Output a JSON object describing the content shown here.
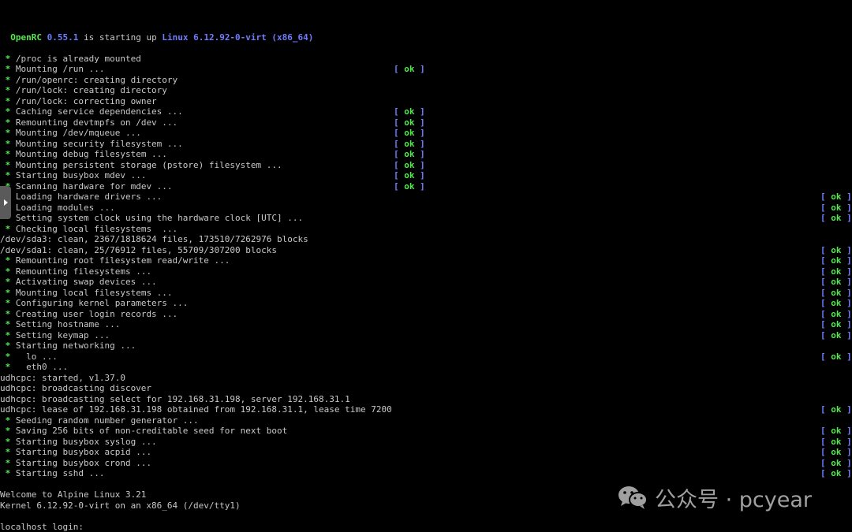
{
  "colors": {
    "background": "#000000",
    "text": "#c9c9c9",
    "green": "#55e84f",
    "blue": "#6f7cff",
    "side_tab": "#5a5a5a"
  },
  "console": {
    "lines": [
      {
        "row": 3,
        "indent": 1,
        "segments": [
          {
            "text": "OpenRC",
            "color": "green"
          },
          {
            "text": " "
          },
          {
            "text": "0.55.1",
            "color": "blue"
          },
          {
            "text": " is starting up "
          },
          {
            "text": "Linux 6.12.92-0-virt (x86_64)",
            "color": "blue"
          }
        ]
      },
      {
        "row": 5,
        "star": true,
        "text": "/proc is already mounted"
      },
      {
        "row": 6,
        "star": true,
        "text": "Mounting /run ...",
        "status": "ok",
        "col": 1
      },
      {
        "row": 7,
        "star": true,
        "text": "/run/openrc: creating directory"
      },
      {
        "row": 8,
        "star": true,
        "text": "/run/lock: creating directory"
      },
      {
        "row": 9,
        "star": true,
        "text": "/run/lock: correcting owner"
      },
      {
        "row": 10,
        "star": true,
        "text": "Caching service dependencies ...",
        "status": "ok",
        "col": 1
      },
      {
        "row": 11,
        "star": true,
        "text": "Remounting devtmpfs on /dev ...",
        "status": "ok",
        "col": 1
      },
      {
        "row": 12,
        "star": true,
        "text": "Mounting /dev/mqueue ...",
        "status": "ok",
        "col": 1
      },
      {
        "row": 13,
        "star": true,
        "text": "Mounting security filesystem ...",
        "status": "ok",
        "col": 1
      },
      {
        "row": 14,
        "star": true,
        "text": "Mounting debug filesystem ...",
        "status": "ok",
        "col": 1
      },
      {
        "row": 15,
        "star": true,
        "text": "Mounting persistent storage (pstore) filesystem ...",
        "status": "ok",
        "col": 1
      },
      {
        "row": 16,
        "star": true,
        "text": "Starting busybox mdev ...",
        "status": "ok",
        "col": 1
      },
      {
        "row": 17,
        "star": true,
        "text": "Scanning hardware for mdev ...",
        "status": "ok",
        "col": 1
      },
      {
        "row": 18,
        "star": true,
        "text": "Loading hardware drivers ...",
        "status": "ok",
        "col": 2
      },
      {
        "row": 19,
        "star": true,
        "text": "Loading modules ...",
        "status": "ok",
        "col": 2
      },
      {
        "row": 20,
        "star": true,
        "text": "Setting system clock using the hardware clock [UTC] ...",
        "status": "ok",
        "col": 2
      },
      {
        "row": 21,
        "star": true,
        "text": "Checking local filesystems  ..."
      },
      {
        "row": 22,
        "text": "/dev/sda3: clean, 2367/1818624 files, 173510/7262976 blocks"
      },
      {
        "row": 23,
        "text": "/dev/sda1: clean, 25/76912 files, 55709/307200 blocks",
        "status": "ok",
        "col": 2
      },
      {
        "row": 24,
        "star": true,
        "text": "Remounting root filesystem read/write ...",
        "status": "ok",
        "col": 2
      },
      {
        "row": 25,
        "star": true,
        "text": "Remounting filesystems ...",
        "status": "ok",
        "col": 2
      },
      {
        "row": 26,
        "star": true,
        "text": "Activating swap devices ...",
        "status": "ok",
        "col": 2
      },
      {
        "row": 27,
        "star": true,
        "text": "Mounting local filesystems ...",
        "status": "ok",
        "col": 2
      },
      {
        "row": 28,
        "star": true,
        "text": "Configuring kernel parameters ...",
        "status": "ok",
        "col": 2
      },
      {
        "row": 29,
        "star": true,
        "text": "Creating user login records ...",
        "status": "ok",
        "col": 2
      },
      {
        "row": 30,
        "star": true,
        "text": "Setting hostname ...",
        "status": "ok",
        "col": 2
      },
      {
        "row": 31,
        "star": true,
        "text": "Setting keymap ...",
        "status": "ok",
        "col": 2
      },
      {
        "row": 32,
        "star": true,
        "text": "Starting networking ..."
      },
      {
        "row": 33,
        "star": true,
        "text": "  lo ...",
        "status": "ok",
        "col": 2
      },
      {
        "row": 34,
        "star": true,
        "text": "  eth0 ..."
      },
      {
        "row": 35,
        "text": "udhcpc: started, v1.37.0"
      },
      {
        "row": 36,
        "text": "udhcpc: broadcasting discover"
      },
      {
        "row": 37,
        "text": "udhcpc: broadcasting select for 192.168.31.198, server 192.168.31.1"
      },
      {
        "row": 38,
        "text": "udhcpc: lease of 192.168.31.198 obtained from 192.168.31.1, lease time 7200",
        "status": "ok",
        "col": 2
      },
      {
        "row": 39,
        "star": true,
        "text": "Seeding random number generator ..."
      },
      {
        "row": 40,
        "star": true,
        "text": "Saving 256 bits of non-creditable seed for next boot",
        "status": "ok",
        "col": 2
      },
      {
        "row": 41,
        "star": true,
        "text": "Starting busybox syslog ...",
        "status": "ok",
        "col": 2
      },
      {
        "row": 42,
        "star": true,
        "text": "Starting busybox acpid ...",
        "status": "ok",
        "col": 2
      },
      {
        "row": 43,
        "star": true,
        "text": "Starting busybox crond ...",
        "status": "ok",
        "col": 2
      },
      {
        "row": 44,
        "star": true,
        "text": "Starting sshd ...",
        "status": "ok",
        "col": 2
      },
      {
        "row": 46,
        "text": "Welcome to Alpine Linux 3.21"
      },
      {
        "row": 47,
        "text": "Kernel 6.12.92-0-virt on an x86_64 (/dev/tty1)"
      },
      {
        "row": 49,
        "text": "localhost login: ",
        "prompt": true
      }
    ],
    "star_glyph": "*",
    "status_open": "[ ",
    "status_close": " ]"
  },
  "side_tab": {
    "icon": "play-arrow-icon"
  },
  "watermark": {
    "icon": "wechat-icon",
    "text": "公众号 · pcyear"
  }
}
